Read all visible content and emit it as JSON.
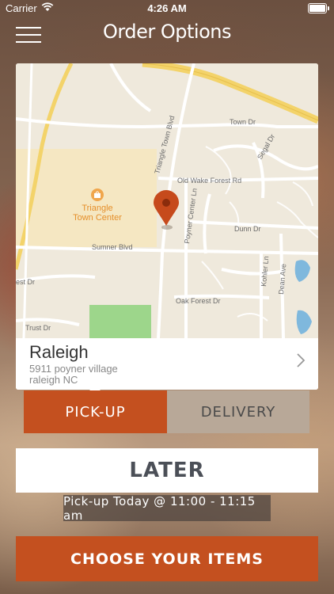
{
  "status_bar": {
    "carrier": "Carrier",
    "time": "4:26 AM"
  },
  "nav": {
    "title": "Order Options"
  },
  "map": {
    "poi_name_line1": "Triangle",
    "poi_name_line2": "Town Center",
    "streets": {
      "town_dr": "Town Dr",
      "segal_dr": "Segal Dr",
      "triangle_town_blvd": "Triangle Town Blvd",
      "old_wake_forest_rd": "Old Wake Forest Rd",
      "poyner_center_ln": "Poyner Center Ln",
      "dunn_dr": "Dunn Dr",
      "sumner_blvd": "Sumner Blvd",
      "kohler_ln": "Kohler Ln",
      "dean_ave": "Dean Ave",
      "est_dr": "est Dr",
      "oak_forest_dr": "Oak Forest Dr",
      "trust_dr": "Trust Dr"
    }
  },
  "location": {
    "name": "Raleigh",
    "address_line1": "5911 poyner village",
    "address_line2": "raleigh NC"
  },
  "order_type": {
    "pickup_label": "PICK-UP",
    "delivery_label": "DELIVERY",
    "selected": "pickup"
  },
  "timing": {
    "later_label": "LATER",
    "pickup_time": "Pick-up Today @ 11:00 - 11:15 am"
  },
  "actions": {
    "choose_items_label": "CHOOSE YOUR ITEMS"
  },
  "colors": {
    "accent": "#c4501f",
    "pin": "#c64a1c",
    "highway": "#f3d36a",
    "park": "#9dd68b",
    "water": "#7fb8dd"
  }
}
